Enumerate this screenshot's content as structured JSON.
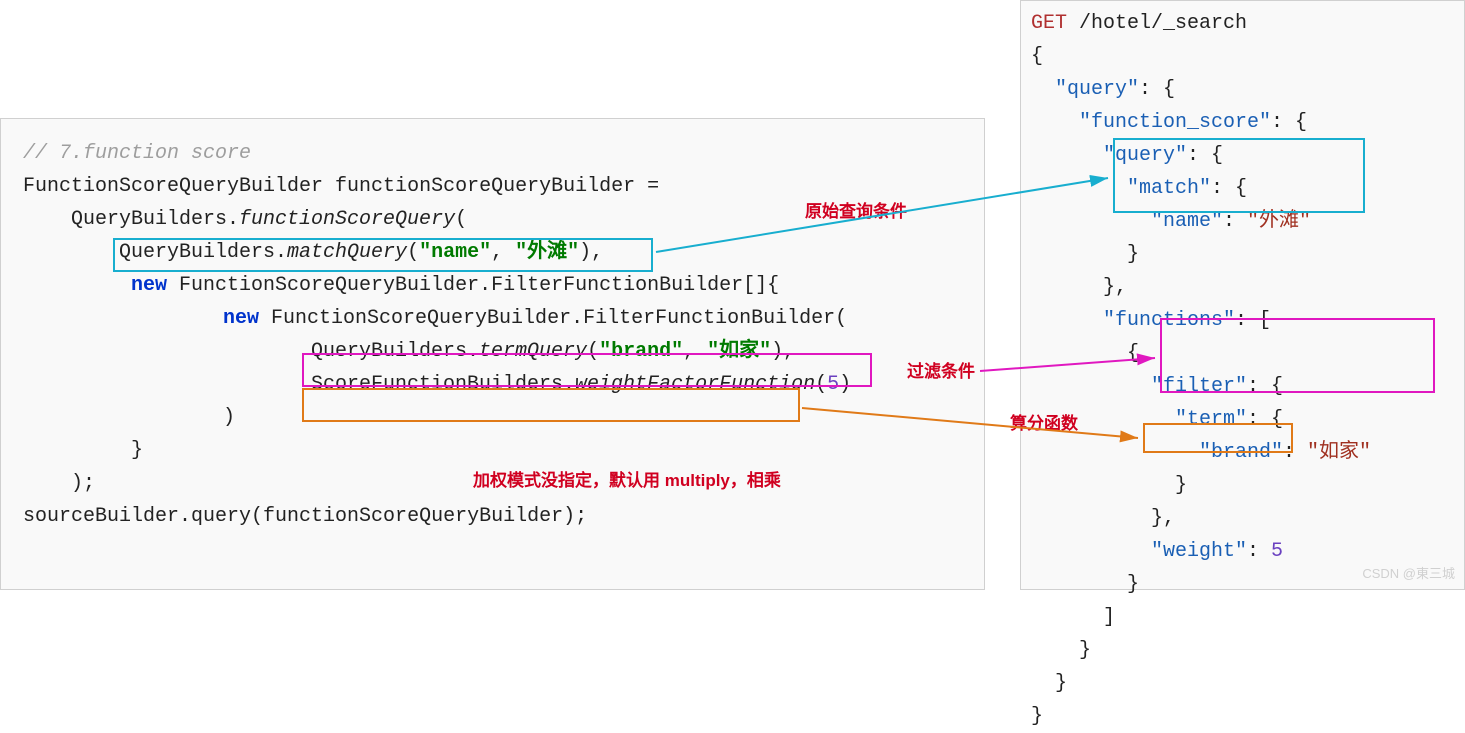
{
  "java": {
    "comment": "// 7.function score",
    "l1a": "FunctionScoreQueryBuilder functionScoreQueryBuilder =",
    "l2a": "QueryBuilders.",
    "l2b": "functionScoreQuery",
    "l2c": "(",
    "l3a": "QueryBuilders.",
    "l3b": "matchQuery",
    "l3c": "(",
    "l3d": "\"name\"",
    "l3e": ", ",
    "l3f": "\"外滩\"",
    "l3g": "),",
    "l4a": "new",
    "l4b": " FunctionScoreQueryBuilder.FilterFunctionBuilder[]{",
    "l5a": "new",
    "l5b": " FunctionScoreQueryBuilder.FilterFunctionBuilder(",
    "l6a": "QueryBuilders.",
    "l6b": "termQuery",
    "l6c": "(",
    "l6d": "\"brand\"",
    "l6e": ", ",
    "l6f": "\"如家\"",
    "l6g": "),",
    "l7a": "ScoreFunctionBuilders.",
    "l7b": "weightFactorFunction",
    "l7c": "(",
    "l7d": "5",
    "l7e": ")",
    "l8": ")",
    "l9": "}",
    "l10": ");",
    "l11": "sourceBuilder.query(functionScoreQueryBuilder);"
  },
  "json": {
    "http1": "GET",
    "http2": " /hotel/_search",
    "k_query": "\"query\"",
    "k_fs": "\"function_score\"",
    "k_match": "\"match\"",
    "k_name": "\"name\"",
    "v_name": "\"外滩\"",
    "k_functions": "\"functions\"",
    "k_filter": "\"filter\"",
    "k_term": "\"term\"",
    "k_brand": "\"brand\"",
    "v_brand": "\"如家\"",
    "k_weight": "\"weight\"",
    "v_weight": "5",
    "brace_o": "{",
    "brace_c": "}",
    "brace_c_comma": "},",
    "brack_o": "[",
    "brack_c": "]",
    "colon_brace": ": {",
    "colon_brack": ": [",
    "colon": ": "
  },
  "annot": {
    "orig": "原始查询条件",
    "filter": "过滤条件",
    "score": "算分函数",
    "mode": "加权模式没指定，默认用 multiply，相乘"
  },
  "watermark": "CSDN @東三城"
}
